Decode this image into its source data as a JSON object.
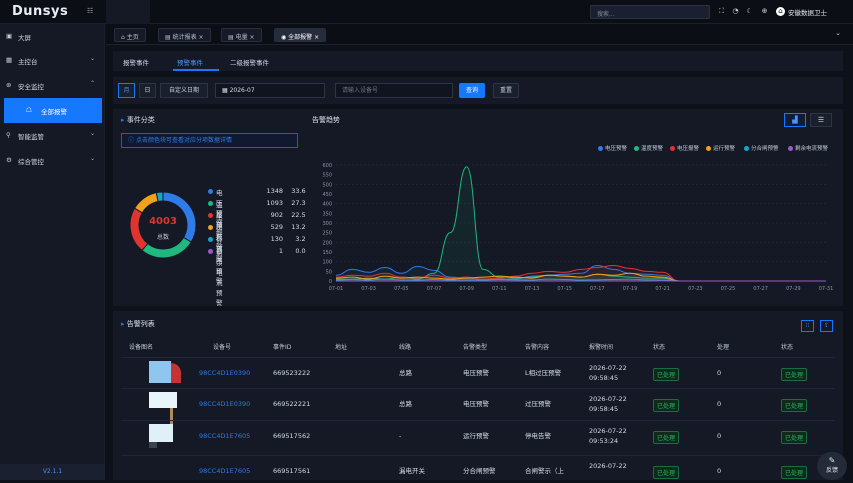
{
  "app": {
    "logo": "Dunsys",
    "search_placeholder": "搜索...",
    "user": "安徽数据卫士"
  },
  "sidebar": {
    "items": [
      {
        "label": "大屏",
        "icon": "screen-icon"
      },
      {
        "label": "主控台",
        "icon": "dashboard-icon"
      },
      {
        "label": "安全监控",
        "icon": "shield-icon"
      },
      {
        "label": "全部报警",
        "icon": "alarm-icon"
      },
      {
        "label": "智能监管",
        "icon": "location-icon"
      },
      {
        "label": "综合管控",
        "icon": "settings-icon"
      }
    ],
    "version": "V2.1.1"
  },
  "tabs": [
    {
      "label": "主页",
      "closable": false
    },
    {
      "label": "统计报表",
      "closable": true
    },
    {
      "label": "电量",
      "closable": true
    },
    {
      "label": "全部报警",
      "closable": true
    }
  ],
  "subtabs": [
    "报警事件",
    "预警事件",
    "二级报警事件"
  ],
  "filter": {
    "segments": [
      "月",
      "日",
      "自定义日期"
    ],
    "date": "2026-07",
    "input_placeholder": "请输入设备号",
    "query": "查询",
    "reset": "重置"
  },
  "events": {
    "title": "事件分类",
    "notice": "点击颜色块可查看对应分项数据详情",
    "total": "4003",
    "total_label": "总数",
    "legend": [
      {
        "name": "电压预警",
        "value": "1348",
        "pct": "33.67%",
        "color": "#2f7be8"
      },
      {
        "name": "温度预警",
        "value": "1093",
        "pct": "27.30%",
        "color": "#1fb87f"
      },
      {
        "name": "电压报警",
        "value": "902",
        "pct": "22.53%",
        "color": "#e0342f"
      },
      {
        "name": "运行预警",
        "value": "529",
        "pct": "13.22%",
        "color": "#f0a21a"
      },
      {
        "name": "分合闸预警",
        "value": "130",
        "pct": "3.25%",
        "color": "#13a8c8"
      },
      {
        "name": "剩余电流预警",
        "value": "1",
        "pct": "0.02%",
        "color": "#9b59d0"
      }
    ]
  },
  "trend": {
    "title": "告警趋势",
    "legend": [
      {
        "name": "电压预警",
        "color": "#2f7be8"
      },
      {
        "name": "温度预警",
        "color": "#1fb87f"
      },
      {
        "name": "电压报警",
        "color": "#e0342f"
      },
      {
        "name": "运行预警",
        "color": "#f0a21a"
      },
      {
        "name": "分合闸预警",
        "color": "#13a8c8"
      },
      {
        "name": "剩余电流预警",
        "color": "#9b59d0"
      }
    ]
  },
  "chart_data": {
    "type": "line",
    "x": [
      "07-01",
      "07-02",
      "07-03",
      "07-04",
      "07-05",
      "07-06",
      "07-07",
      "07-08",
      "07-09",
      "07-10",
      "07-11",
      "07-12",
      "07-13",
      "07-14",
      "07-15",
      "07-16",
      "07-17",
      "07-18",
      "07-19",
      "07-20",
      "07-21",
      "07-22",
      "07-23",
      "07-24",
      "07-25",
      "07-26",
      "07-27",
      "07-28",
      "07-29",
      "07-30",
      "07-31"
    ],
    "x_tick_labels": [
      "07-01",
      "07-03",
      "07-05",
      "07-07",
      "07-09",
      "07-11",
      "07-13",
      "07-15",
      "07-17",
      "07-19",
      "07-21",
      "07-23",
      "07-25",
      "07-27",
      "07-29",
      "07-31"
    ],
    "ylim": [
      0,
      600
    ],
    "yticks": [
      0,
      50,
      100,
      150,
      200,
      250,
      300,
      350,
      400,
      450,
      500,
      550,
      600
    ],
    "series": [
      {
        "name": "电压预警",
        "color": "#2f7be8",
        "values": [
          30,
          60,
          45,
          70,
          40,
          75,
          55,
          20,
          15,
          10,
          10,
          10,
          25,
          30,
          35,
          40,
          80,
          60,
          40,
          35,
          30,
          0,
          0,
          0,
          0,
          0,
          0,
          0,
          0,
          0,
          0
        ]
      },
      {
        "name": "温度预警",
        "color": "#1fb87f",
        "values": [
          10,
          10,
          15,
          10,
          20,
          10,
          40,
          250,
          590,
          60,
          20,
          15,
          20,
          30,
          25,
          20,
          35,
          25,
          20,
          15,
          15,
          0,
          0,
          0,
          0,
          0,
          0,
          0,
          0,
          0,
          0
        ]
      },
      {
        "name": "电压报警",
        "color": "#e0342f",
        "values": [
          20,
          30,
          25,
          40,
          20,
          15,
          30,
          15,
          20,
          10,
          15,
          25,
          40,
          50,
          45,
          60,
          70,
          80,
          65,
          50,
          45,
          0,
          0,
          0,
          0,
          0,
          0,
          0,
          0,
          0,
          0
        ]
      },
      {
        "name": "运行预警",
        "color": "#f0a21a",
        "values": [
          15,
          20,
          10,
          25,
          15,
          20,
          15,
          10,
          15,
          20,
          25,
          20,
          15,
          30,
          25,
          20,
          35,
          30,
          40,
          25,
          20,
          0,
          0,
          0,
          0,
          0,
          0,
          0,
          0,
          0,
          0
        ]
      },
      {
        "name": "分合闸预警",
        "color": "#13a8c8",
        "values": [
          5,
          8,
          5,
          10,
          6,
          5,
          8,
          5,
          6,
          5,
          8,
          6,
          5,
          10,
          8,
          5,
          6,
          8,
          10,
          6,
          5,
          0,
          0,
          0,
          0,
          0,
          0,
          0,
          0,
          0,
          0
        ]
      },
      {
        "name": "剩余电流预警",
        "color": "#9b59d0",
        "values": [
          0,
          0,
          0,
          0,
          0,
          0,
          0,
          0,
          0,
          0,
          0,
          0,
          0,
          0,
          0,
          0,
          0,
          0,
          0,
          0,
          1,
          0,
          0,
          0,
          0,
          0,
          0,
          0,
          0,
          0,
          0
        ]
      }
    ]
  },
  "alarm_list": {
    "title": "告警列表",
    "headers": [
      "设备图名",
      "设备号",
      "事件ID",
      "地址",
      "线路",
      "告警类型",
      "告警内容",
      "报警时间",
      "状态",
      "处理",
      "状态"
    ],
    "rows": [
      {
        "device": "98CC4D1E0390",
        "event_id": "669523222",
        "line": "总路",
        "type": "电压预警",
        "content": "L相过压预警",
        "time1": "2026-07-22",
        "time2": "09:58:45",
        "status": "已处理",
        "handle": "0",
        "status2": "已处理"
      },
      {
        "device": "98CC4D1E0390",
        "event_id": "669522221",
        "line": "总路",
        "type": "电压预警",
        "content": "过压预警",
        "time1": "2026-07-22",
        "time2": "09:58:45",
        "status": "已处理",
        "handle": "0",
        "status2": "已处理"
      },
      {
        "device": "98CC4D1E7605",
        "event_id": "669517562",
        "line": "-",
        "type": "运行预警",
        "content": "停电告警",
        "time1": "2026-07-22",
        "time2": "09:53:24",
        "status": "已处理",
        "handle": "0",
        "status2": "已处理"
      },
      {
        "device": "98CC4D1E7605",
        "event_id": "669517561",
        "line": "漏电开关",
        "type": "分合闸预警",
        "content": "合闸警示（上",
        "time1": "2026-07-22",
        "time2": "",
        "status": "已处理",
        "handle": "0",
        "status2": "已处理"
      }
    ]
  },
  "fab": {
    "label": "反馈"
  }
}
